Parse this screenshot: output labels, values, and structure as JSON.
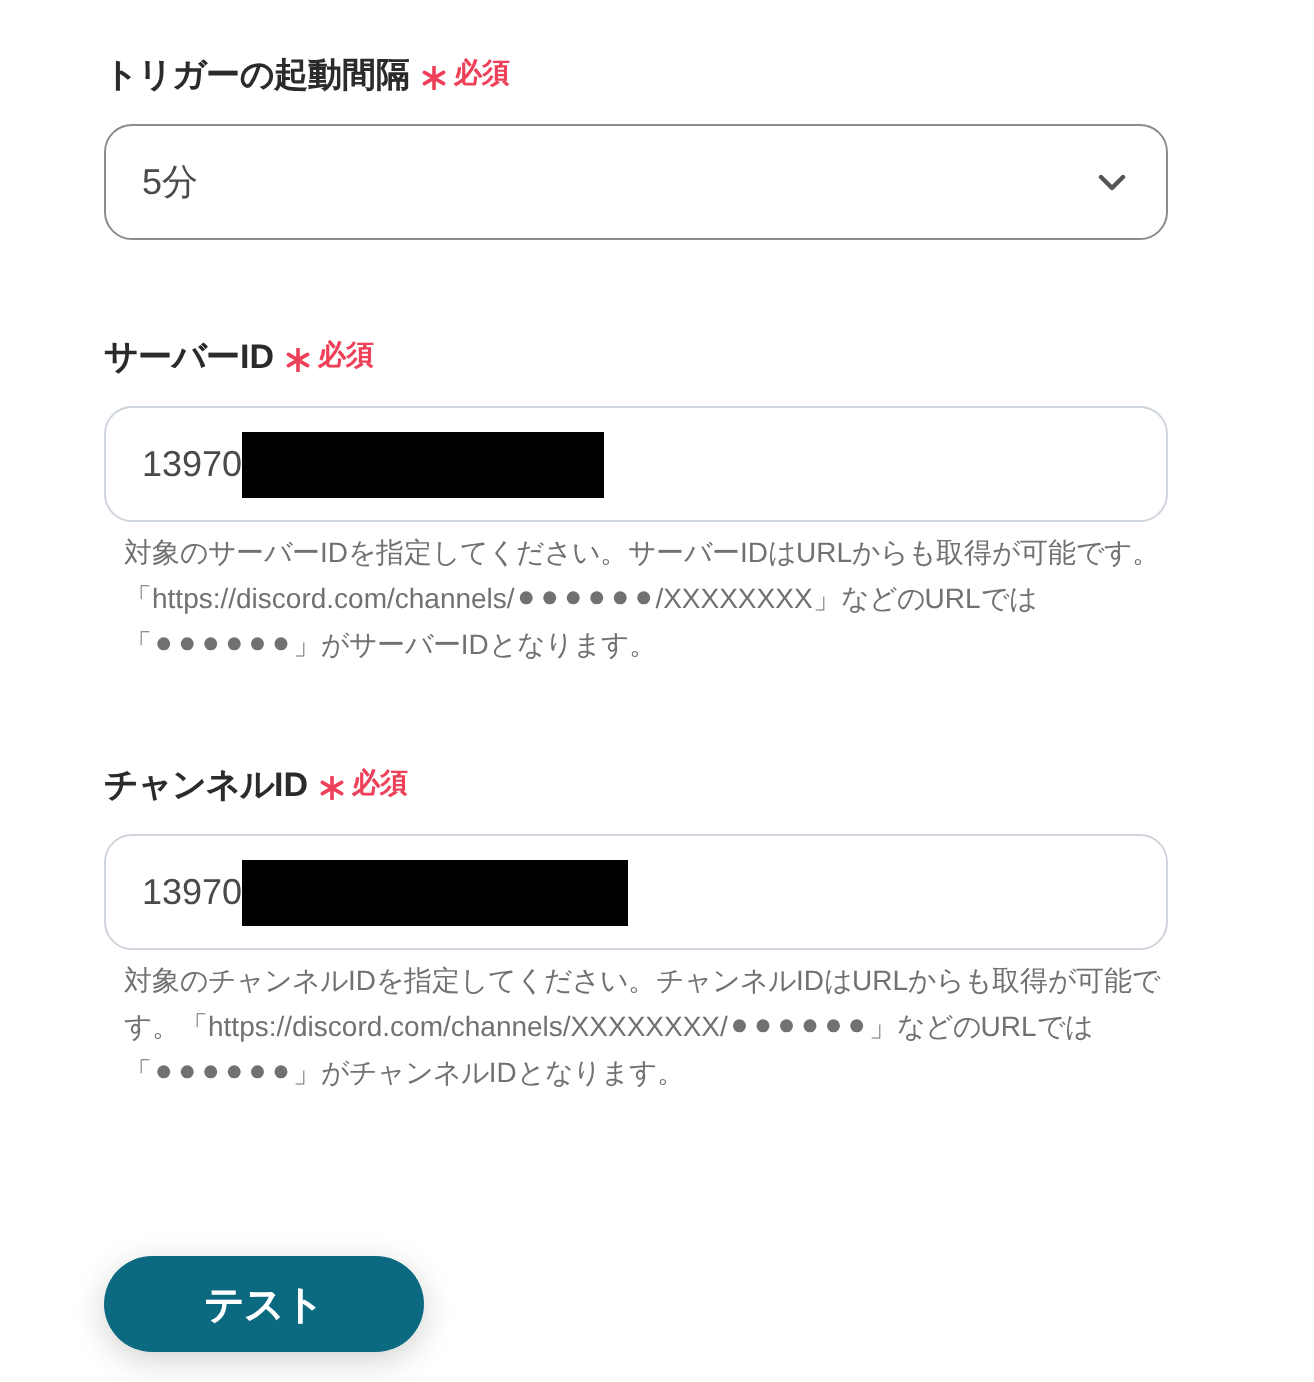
{
  "fields": [
    {
      "kind": "select",
      "label": "トリガーの起動間隔",
      "required": true,
      "required_label": "必須",
      "value": "5分"
    },
    {
      "kind": "input",
      "label": "サーバーID",
      "required": true,
      "required_label": "必須",
      "value": "13970",
      "redacted": true,
      "help": "対象のサーバーIDを指定してください。サーバーIDはURLからも取得が可能です。「https://discord.com/channels/⚫⚫⚫⚫⚫⚫/XXXXXXXX」などのURLでは「⚫⚫⚫⚫⚫⚫」がサーバーIDとなります。"
    },
    {
      "kind": "input",
      "label": "チャンネルID",
      "required": true,
      "required_label": "必須",
      "value": "13970",
      "redacted": true,
      "help": "対象のチャンネルIDを指定してください。チャンネルIDはURLからも取得が可能です。「https://discord.com/channels/XXXXXXXX/⚫⚫⚫⚫⚫⚫」などのURLでは「⚫⚫⚫⚫⚫⚫」がチャンネルIDとなります。"
    }
  ],
  "button": {
    "label": "テスト"
  }
}
